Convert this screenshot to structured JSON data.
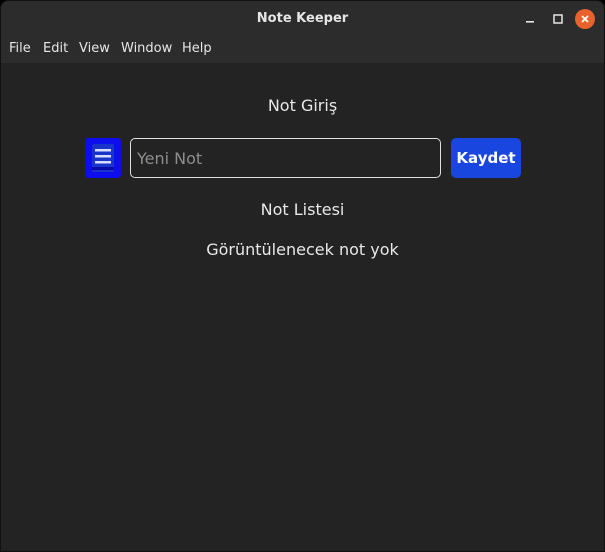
{
  "window": {
    "title": "Note Keeper",
    "controls": {
      "minimize_icon": "minimize-icon",
      "maximize_icon": "maximize-icon",
      "close_icon": "close-icon"
    }
  },
  "menubar": {
    "items": [
      {
        "label": "File"
      },
      {
        "label": "Edit"
      },
      {
        "label": "View"
      },
      {
        "label": "Window"
      },
      {
        "label": "Help"
      }
    ]
  },
  "entry": {
    "heading": "Not Giriş",
    "icon": "notebook-icon",
    "input_value": "",
    "input_placeholder": "Yeni Not",
    "save_label": "Kaydet"
  },
  "list": {
    "heading": "Not Listesi",
    "empty_message": "Görüntülenecek not yok"
  },
  "colors": {
    "background": "#232323",
    "titlebar": "#2c2c2c",
    "accent_button": "#1a46e0",
    "icon_blue": "#0d0dee",
    "close_button": "#e9612c"
  }
}
